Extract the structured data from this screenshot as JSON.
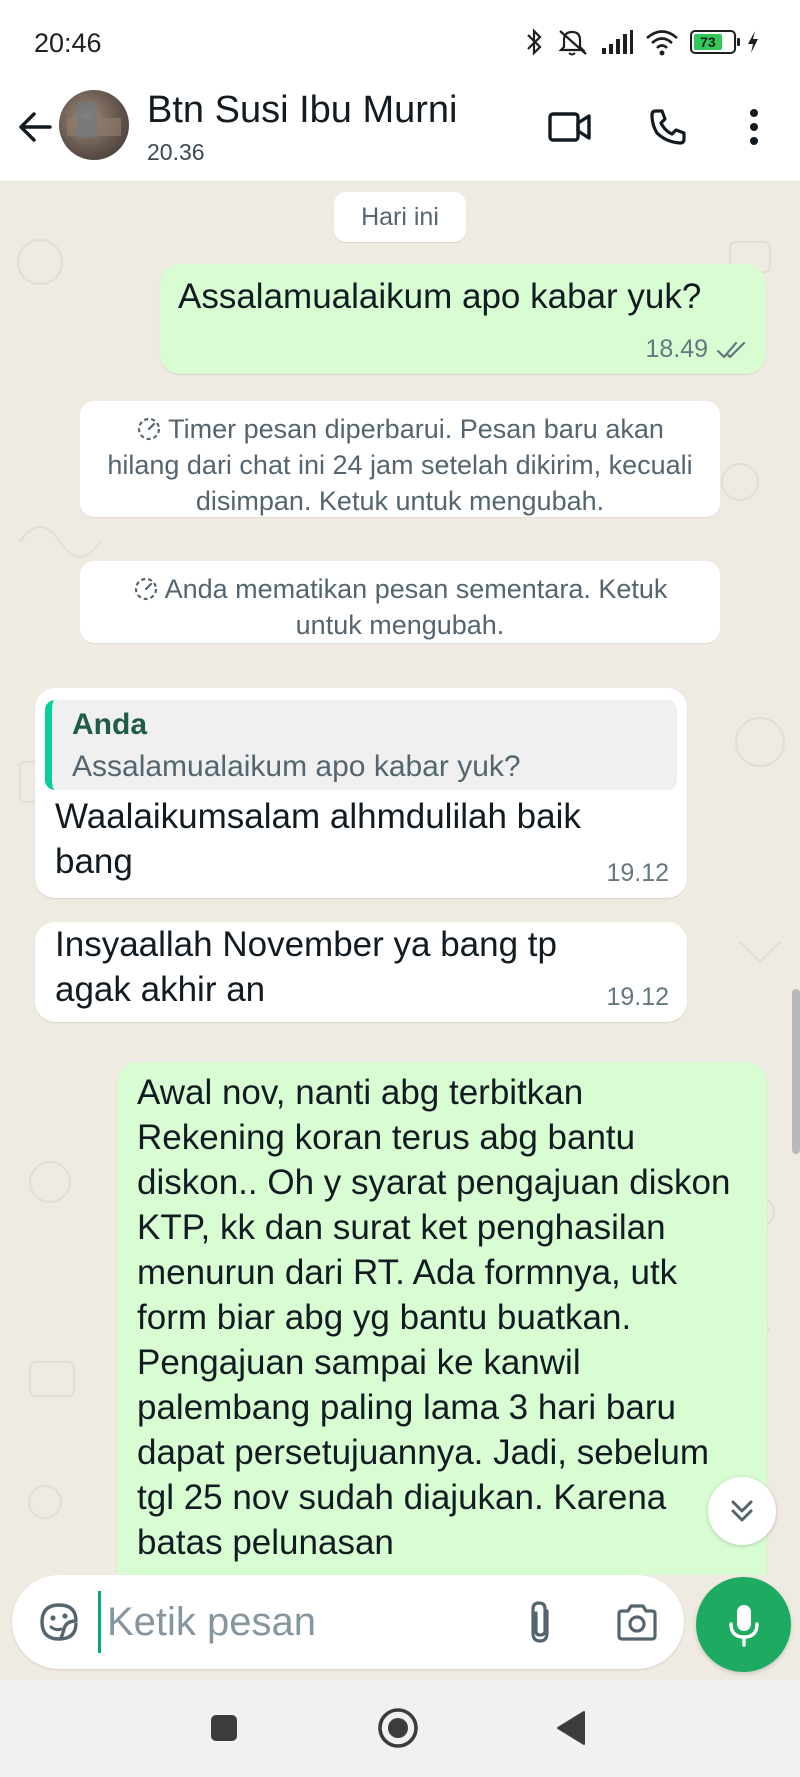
{
  "status": {
    "time": "20:46",
    "battery": "73",
    "icons": [
      "bluetooth-icon",
      "mute-icon",
      "signal-icon",
      "wifi-icon",
      "battery-icon",
      "charging-icon"
    ]
  },
  "header": {
    "name": "Btn Susi Ibu Murni",
    "last_seen": "20.36",
    "actions": [
      "video-call-icon",
      "phone-icon",
      "more-vert-icon"
    ]
  },
  "chat": {
    "date_chip": "Hari ini",
    "messages": [
      {
        "text": "Assalamualaikum apo kabar yuk?",
        "time": "18.49",
        "status": "read"
      },
      {
        "system": "Timer pesan diperbarui. Pesan baru akan hilang dari chat ini 24 jam setelah dikirim, kecuali disimpan. Ketuk untuk mengubah."
      },
      {
        "system": "Anda mematikan pesan sementara. Ketuk untuk mengubah."
      },
      {
        "quote_author": "Anda",
        "quote_text": "Assalamualaikum apo kabar yuk?",
        "text": "Waalaikumsalam alhmdulilah baik bang",
        "time": "19.12"
      },
      {
        "text": "Insyaallah November ya bang tp agak akhir an",
        "time": "19.12"
      },
      {
        "text": "Awal nov, nanti abg terbitkan Rekening koran terus abg bantu diskon.. Oh y syarat pengajuan diskon KTP, kk dan surat ket penghasilan menurun dari RT. Ada formnya, utk form biar abg yg bantu buatkan. Pengajuan sampai ke kanwil palembang paling lama 3 hari baru dapat persetujuannya. Jadi, sebelum tgl 25 nov sudah diajukan. Karena batas pelunasan"
      }
    ]
  },
  "composer": {
    "placeholder": "Ketik pesan"
  },
  "colors": {
    "outgoing_bubble": "#d9fdd3",
    "incoming_bubble": "#ffffff",
    "chat_bg": "#efeae2",
    "accent": "#1daa61",
    "read_tick": "#667781"
  }
}
